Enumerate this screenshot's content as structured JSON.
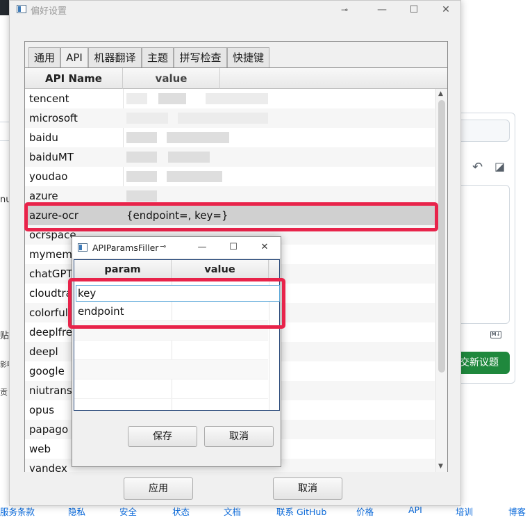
{
  "window": {
    "title": "偏好设置",
    "pin_glyph": "⊸",
    "minimize_glyph": "—",
    "maximize_glyph": "☐",
    "close_glyph": "✕"
  },
  "tabs": [
    {
      "label": "通用"
    },
    {
      "label": "API"
    },
    {
      "label": "机器翻译"
    },
    {
      "label": "主题"
    },
    {
      "label": "拼写检查"
    },
    {
      "label": "快捷键"
    }
  ],
  "api_table": {
    "headers": [
      "API Name",
      "value"
    ],
    "rows": [
      {
        "name": "tencent",
        "value": ""
      },
      {
        "name": "microsoft",
        "value": ""
      },
      {
        "name": "baidu",
        "value": ""
      },
      {
        "name": "baiduMT",
        "value": ""
      },
      {
        "name": "youdao",
        "value": ""
      },
      {
        "name": "azure",
        "value": ""
      },
      {
        "name": "azure-ocr",
        "value": "{endpoint=, key=}"
      },
      {
        "name": "ocrspace",
        "value": ""
      },
      {
        "name": "mymemory",
        "value": ""
      },
      {
        "name": "chatGPT",
        "value": ""
      },
      {
        "name": "cloudtranslation",
        "value": ""
      },
      {
        "name": "colorfulclouds",
        "value": ""
      },
      {
        "name": "deeplfree",
        "value": ""
      },
      {
        "name": "deepl",
        "value": ""
      },
      {
        "name": "google",
        "value": ""
      },
      {
        "name": "niutrans",
        "value": ""
      },
      {
        "name": "opus",
        "value": ""
      },
      {
        "name": "papago",
        "value": ""
      },
      {
        "name": "web",
        "value": ""
      },
      {
        "name": "yandex",
        "value": ""
      }
    ],
    "selected_row": "azure-ocr"
  },
  "footer_buttons": {
    "apply": "应用",
    "cancel": "取消"
  },
  "popup": {
    "title": "APIParamsFiller",
    "headers": [
      "param",
      "value"
    ],
    "rows": [
      {
        "param": "key",
        "value": ""
      },
      {
        "param": "endpoint",
        "value": ""
      }
    ],
    "save_label": "保存",
    "cancel_label": "取消"
  },
  "background": {
    "submit_label": "交新议题",
    "left_fragments": [
      "nu",
      "贴",
      "影响",
      "贡"
    ],
    "md_badge": "M↓",
    "footer_links": [
      "服务条款",
      "隐私",
      "安全",
      "状态",
      "文档",
      "联系 GitHub",
      "价格",
      "API",
      "培训",
      "博客"
    ]
  },
  "colors": {
    "highlight": "#e8234a",
    "submit_green": "#1f883d",
    "footer_link": "#0969da"
  }
}
